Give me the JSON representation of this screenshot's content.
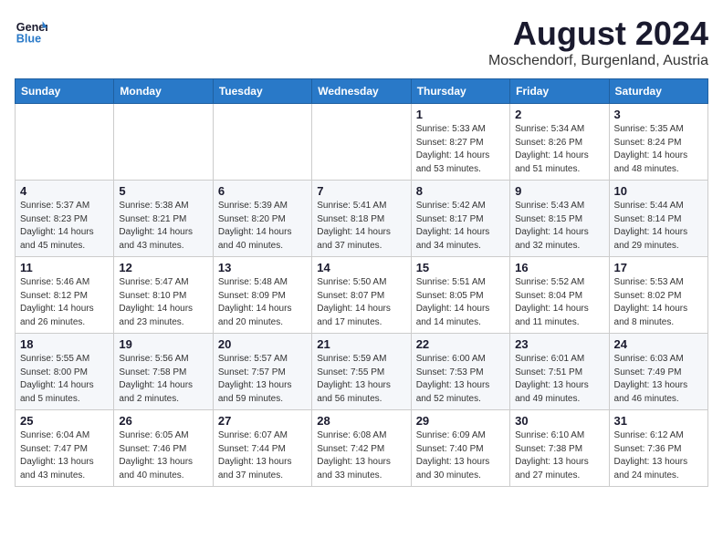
{
  "header": {
    "logo_line1": "General",
    "logo_line2": "Blue",
    "title": "August 2024",
    "subtitle": "Moschendorf, Burgenland, Austria"
  },
  "days_of_week": [
    "Sunday",
    "Monday",
    "Tuesday",
    "Wednesday",
    "Thursday",
    "Friday",
    "Saturday"
  ],
  "weeks": [
    [
      {
        "day": "",
        "info": ""
      },
      {
        "day": "",
        "info": ""
      },
      {
        "day": "",
        "info": ""
      },
      {
        "day": "",
        "info": ""
      },
      {
        "day": "1",
        "info": "Sunrise: 5:33 AM\nSunset: 8:27 PM\nDaylight: 14 hours\nand 53 minutes."
      },
      {
        "day": "2",
        "info": "Sunrise: 5:34 AM\nSunset: 8:26 PM\nDaylight: 14 hours\nand 51 minutes."
      },
      {
        "day": "3",
        "info": "Sunrise: 5:35 AM\nSunset: 8:24 PM\nDaylight: 14 hours\nand 48 minutes."
      }
    ],
    [
      {
        "day": "4",
        "info": "Sunrise: 5:37 AM\nSunset: 8:23 PM\nDaylight: 14 hours\nand 45 minutes."
      },
      {
        "day": "5",
        "info": "Sunrise: 5:38 AM\nSunset: 8:21 PM\nDaylight: 14 hours\nand 43 minutes."
      },
      {
        "day": "6",
        "info": "Sunrise: 5:39 AM\nSunset: 8:20 PM\nDaylight: 14 hours\nand 40 minutes."
      },
      {
        "day": "7",
        "info": "Sunrise: 5:41 AM\nSunset: 8:18 PM\nDaylight: 14 hours\nand 37 minutes."
      },
      {
        "day": "8",
        "info": "Sunrise: 5:42 AM\nSunset: 8:17 PM\nDaylight: 14 hours\nand 34 minutes."
      },
      {
        "day": "9",
        "info": "Sunrise: 5:43 AM\nSunset: 8:15 PM\nDaylight: 14 hours\nand 32 minutes."
      },
      {
        "day": "10",
        "info": "Sunrise: 5:44 AM\nSunset: 8:14 PM\nDaylight: 14 hours\nand 29 minutes."
      }
    ],
    [
      {
        "day": "11",
        "info": "Sunrise: 5:46 AM\nSunset: 8:12 PM\nDaylight: 14 hours\nand 26 minutes."
      },
      {
        "day": "12",
        "info": "Sunrise: 5:47 AM\nSunset: 8:10 PM\nDaylight: 14 hours\nand 23 minutes."
      },
      {
        "day": "13",
        "info": "Sunrise: 5:48 AM\nSunset: 8:09 PM\nDaylight: 14 hours\nand 20 minutes."
      },
      {
        "day": "14",
        "info": "Sunrise: 5:50 AM\nSunset: 8:07 PM\nDaylight: 14 hours\nand 17 minutes."
      },
      {
        "day": "15",
        "info": "Sunrise: 5:51 AM\nSunset: 8:05 PM\nDaylight: 14 hours\nand 14 minutes."
      },
      {
        "day": "16",
        "info": "Sunrise: 5:52 AM\nSunset: 8:04 PM\nDaylight: 14 hours\nand 11 minutes."
      },
      {
        "day": "17",
        "info": "Sunrise: 5:53 AM\nSunset: 8:02 PM\nDaylight: 14 hours\nand 8 minutes."
      }
    ],
    [
      {
        "day": "18",
        "info": "Sunrise: 5:55 AM\nSunset: 8:00 PM\nDaylight: 14 hours\nand 5 minutes."
      },
      {
        "day": "19",
        "info": "Sunrise: 5:56 AM\nSunset: 7:58 PM\nDaylight: 14 hours\nand 2 minutes."
      },
      {
        "day": "20",
        "info": "Sunrise: 5:57 AM\nSunset: 7:57 PM\nDaylight: 13 hours\nand 59 minutes."
      },
      {
        "day": "21",
        "info": "Sunrise: 5:59 AM\nSunset: 7:55 PM\nDaylight: 13 hours\nand 56 minutes."
      },
      {
        "day": "22",
        "info": "Sunrise: 6:00 AM\nSunset: 7:53 PM\nDaylight: 13 hours\nand 52 minutes."
      },
      {
        "day": "23",
        "info": "Sunrise: 6:01 AM\nSunset: 7:51 PM\nDaylight: 13 hours\nand 49 minutes."
      },
      {
        "day": "24",
        "info": "Sunrise: 6:03 AM\nSunset: 7:49 PM\nDaylight: 13 hours\nand 46 minutes."
      }
    ],
    [
      {
        "day": "25",
        "info": "Sunrise: 6:04 AM\nSunset: 7:47 PM\nDaylight: 13 hours\nand 43 minutes."
      },
      {
        "day": "26",
        "info": "Sunrise: 6:05 AM\nSunset: 7:46 PM\nDaylight: 13 hours\nand 40 minutes."
      },
      {
        "day": "27",
        "info": "Sunrise: 6:07 AM\nSunset: 7:44 PM\nDaylight: 13 hours\nand 37 minutes."
      },
      {
        "day": "28",
        "info": "Sunrise: 6:08 AM\nSunset: 7:42 PM\nDaylight: 13 hours\nand 33 minutes."
      },
      {
        "day": "29",
        "info": "Sunrise: 6:09 AM\nSunset: 7:40 PM\nDaylight: 13 hours\nand 30 minutes."
      },
      {
        "day": "30",
        "info": "Sunrise: 6:10 AM\nSunset: 7:38 PM\nDaylight: 13 hours\nand 27 minutes."
      },
      {
        "day": "31",
        "info": "Sunrise: 6:12 AM\nSunset: 7:36 PM\nDaylight: 13 hours\nand 24 minutes."
      }
    ]
  ]
}
